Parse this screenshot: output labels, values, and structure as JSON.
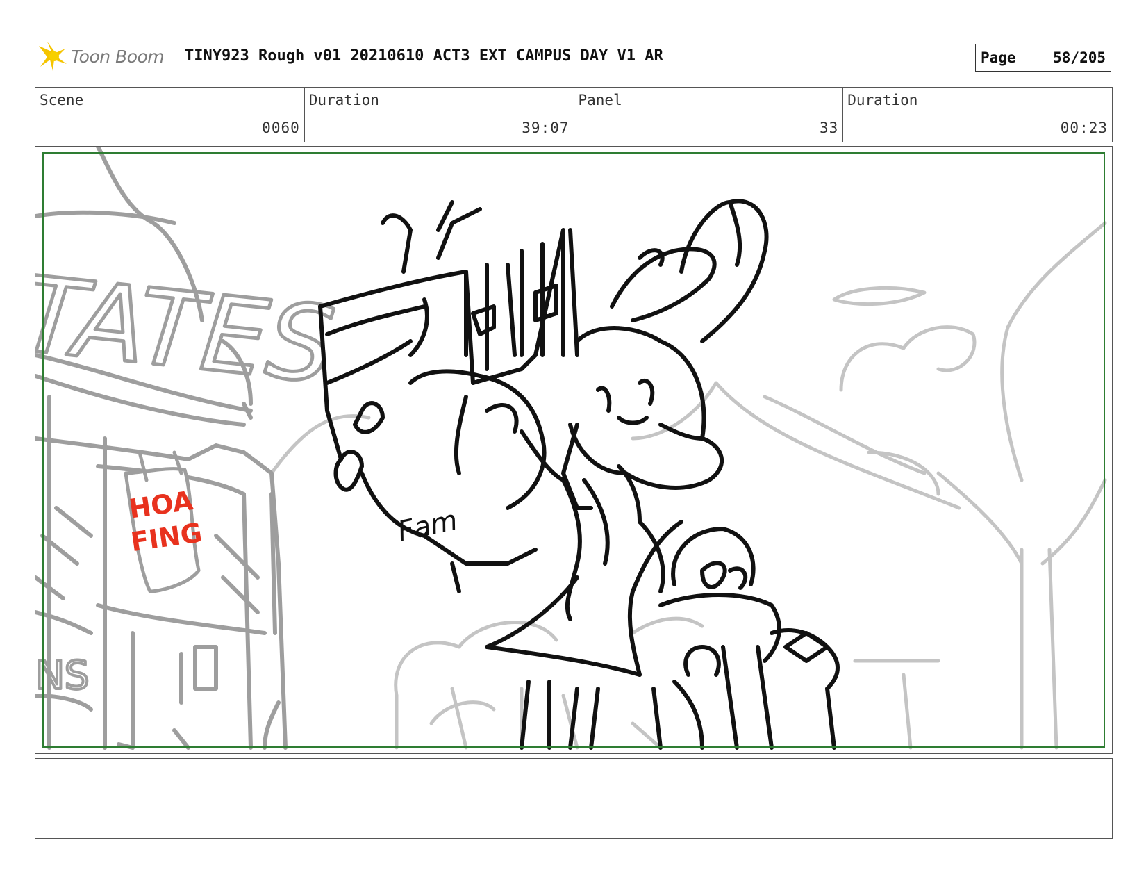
{
  "header": {
    "logo_text": "Toon Boom",
    "title": "TINY923 Rough v01 20210610 ACT3 EXT CAMPUS DAY V1 AR",
    "page_label": "Page",
    "page_value": "58/205"
  },
  "info": {
    "scene_label": "Scene",
    "scene_value": "0060",
    "duration_label": "Duration",
    "duration_value": "39:07",
    "panel_label": "Panel",
    "panel_value": "33",
    "panel_duration_label": "Duration",
    "panel_duration_value": "00:23"
  },
  "sketch": {
    "sign_text": "TATES",
    "poster_line1": "HOA",
    "poster_line2": "FING",
    "book_text": "Fam",
    "sign_sub": "NS",
    "colors": {
      "bg_lines": "#9e9e9e",
      "far_lines": "#c4c4c4",
      "ink": "#111111",
      "poster": "#e8321e",
      "safe_area": "#2e7d32"
    }
  },
  "notes": {
    "text": ""
  }
}
